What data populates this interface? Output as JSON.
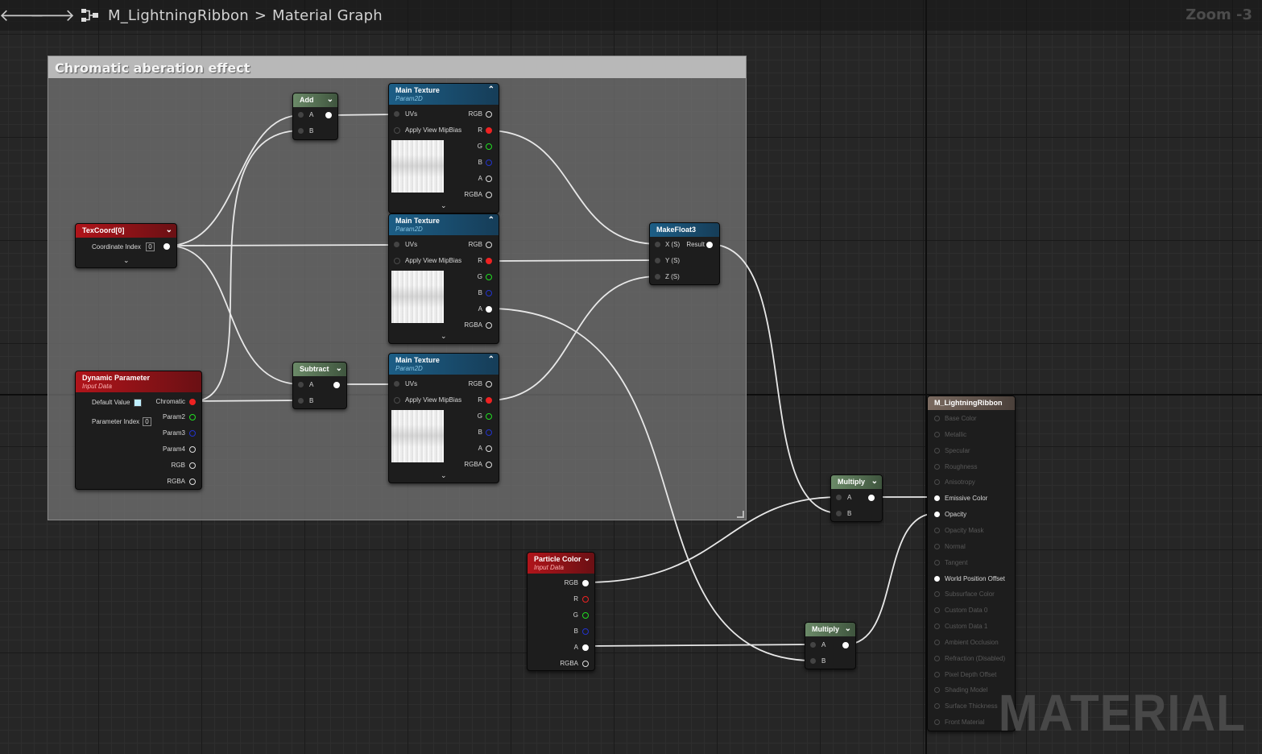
{
  "toolbar": {
    "back_icon": "arrow-left-icon",
    "forward_icon": "arrow-right-icon",
    "graph_icon": "graph-hierarchy-icon",
    "asset_name": "M_LightningRibbon",
    "separator": ">",
    "graph_name": "Material Graph",
    "zoom": "Zoom -3"
  },
  "watermark": "MATERIAL",
  "comment": {
    "title": "Chromatic aberation effect"
  },
  "nodes": {
    "add": {
      "title": "Add",
      "pin_a": "A",
      "pin_b": "B"
    },
    "subtract": {
      "title": "Subtract",
      "pin_a": "A",
      "pin_b": "B"
    },
    "texcoord": {
      "title": "TexCoord[0]",
      "label": "Coordinate Index",
      "value": "0"
    },
    "dynparam": {
      "title": "Dynamic Parameter",
      "subtitle": "Input Data",
      "default_label": "Default Value",
      "default_color": "#bfefff",
      "index_label": "Parameter Index",
      "index_value": "0",
      "out1": "Chromatic",
      "out2": "Param2",
      "out3": "Param3",
      "out4": "Param4",
      "out5": "RGB",
      "out6": "RGBA"
    },
    "tex": [
      {
        "title": "Main Texture",
        "subtitle": "Param2D",
        "in1": "UVs",
        "in2": "Apply View MipBias",
        "o1": "RGB",
        "o2": "R",
        "o3": "G",
        "o4": "B",
        "o5": "A",
        "o6": "RGBA"
      },
      {
        "title": "Main Texture",
        "subtitle": "Param2D",
        "in1": "UVs",
        "in2": "Apply View MipBias",
        "o1": "RGB",
        "o2": "R",
        "o3": "G",
        "o4": "B",
        "o5": "A",
        "o6": "RGBA"
      },
      {
        "title": "Main Texture",
        "subtitle": "Param2D",
        "in1": "UVs",
        "in2": "Apply View MipBias",
        "o1": "RGB",
        "o2": "R",
        "o3": "G",
        "o4": "B",
        "o5": "A",
        "o6": "RGBA"
      }
    ],
    "makefloat3": {
      "title": "MakeFloat3",
      "x": "X (S)",
      "y": "Y (S)",
      "z": "Z (S)",
      "result": "Result"
    },
    "particle": {
      "title": "Particle Color",
      "subtitle": "Input Data",
      "o1": "RGB",
      "o2": "R",
      "o3": "G",
      "o4": "B",
      "o5": "A",
      "o6": "RGBA"
    },
    "multiply1": {
      "title": "Multiply",
      "pin_a": "A",
      "pin_b": "B"
    },
    "multiply2": {
      "title": "Multiply",
      "pin_a": "A",
      "pin_b": "B"
    },
    "result": {
      "title": "M_LightningRibbon",
      "inputs": [
        {
          "label": "Base Color",
          "active": false
        },
        {
          "label": "Metallic",
          "active": false
        },
        {
          "label": "Specular",
          "active": false
        },
        {
          "label": "Roughness",
          "active": false
        },
        {
          "label": "Anisotropy",
          "active": false
        },
        {
          "label": "Emissive Color",
          "active": true
        },
        {
          "label": "Opacity",
          "active": true
        },
        {
          "label": "Opacity Mask",
          "active": false
        },
        {
          "label": "Normal",
          "active": false
        },
        {
          "label": "Tangent",
          "active": false
        },
        {
          "label": "World Position Offset",
          "active": true
        },
        {
          "label": "Subsurface Color",
          "active": false
        },
        {
          "label": "Custom Data 0",
          "active": false
        },
        {
          "label": "Custom Data 1",
          "active": false
        },
        {
          "label": "Ambient Occlusion",
          "active": false
        },
        {
          "label": "Refraction (Disabled)",
          "active": false
        },
        {
          "label": "Pixel Depth Offset",
          "active": false
        },
        {
          "label": "Shading Model",
          "active": false
        },
        {
          "label": "Surface Thickness",
          "active": false
        },
        {
          "label": "Front Material",
          "active": false
        }
      ]
    }
  }
}
